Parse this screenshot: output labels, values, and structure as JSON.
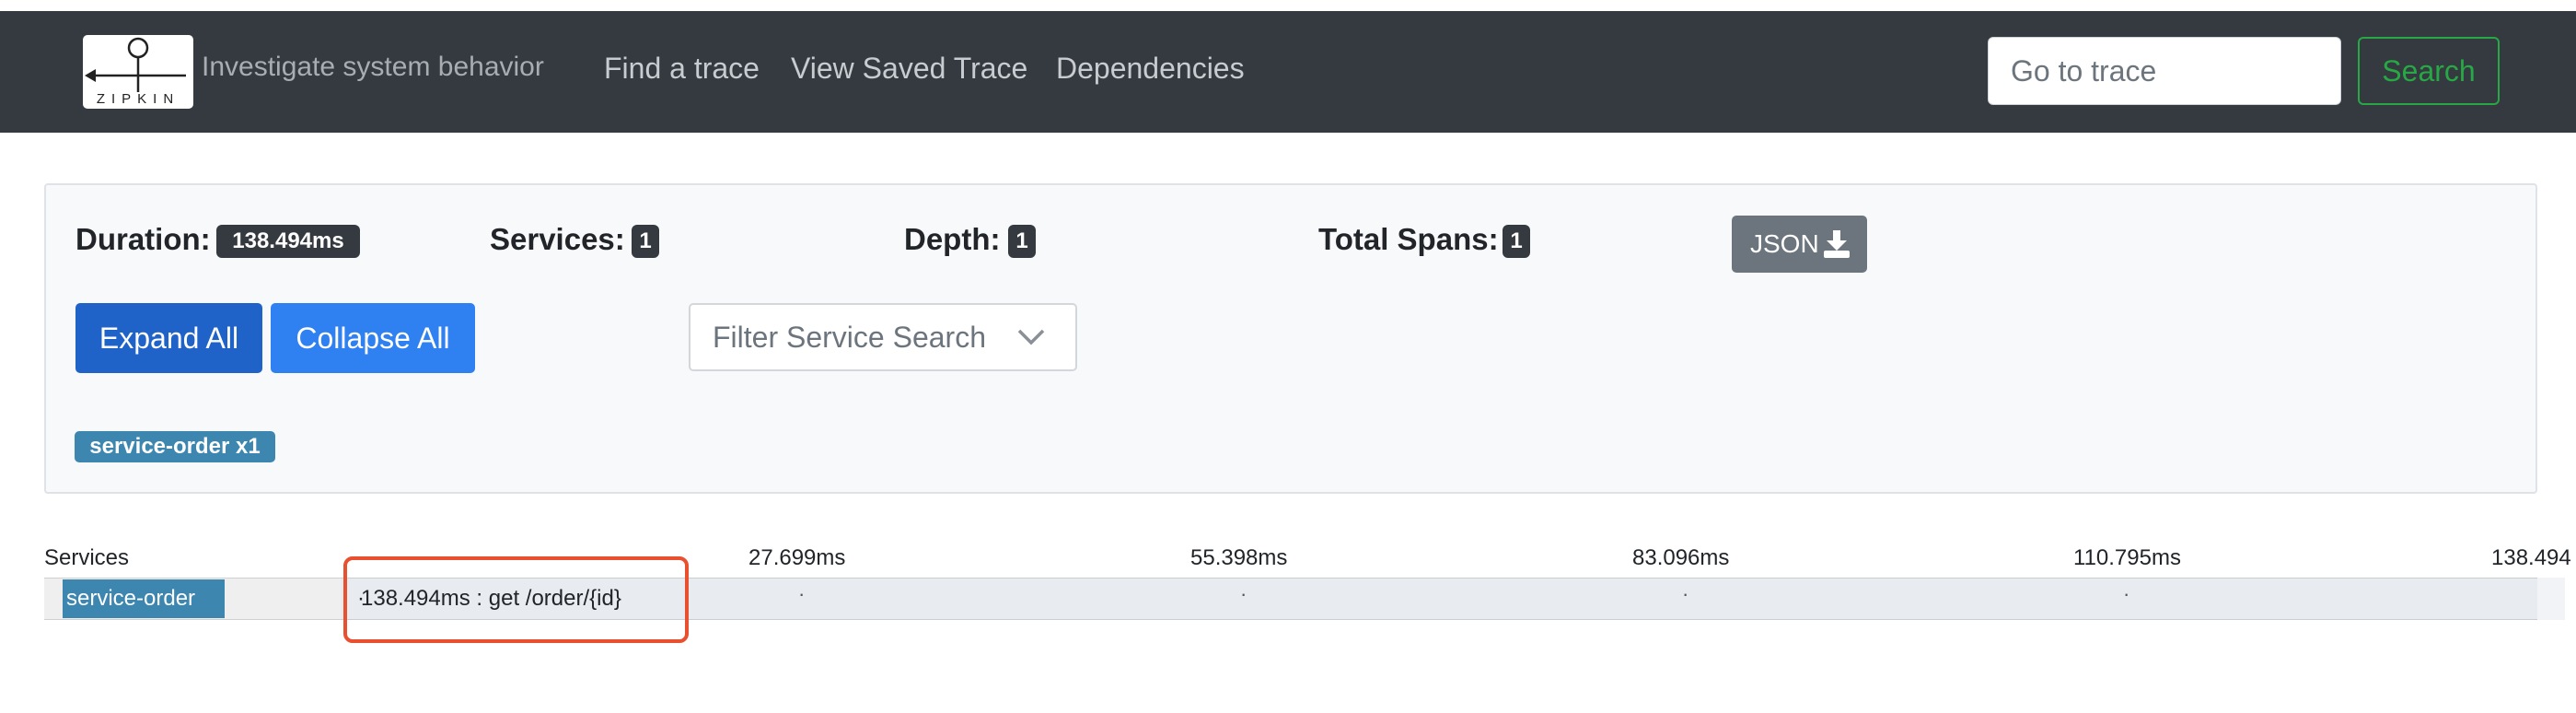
{
  "navbar": {
    "logo_text": "ZIPKIN",
    "tagline": "Investigate system behavior",
    "links": [
      "Find a trace",
      "View Saved Trace",
      "Dependencies"
    ],
    "goto_placeholder": "Go to trace",
    "search_label": "Search"
  },
  "summary": {
    "duration_label": "Duration:",
    "duration_value": "138.494ms",
    "services_label": "Services:",
    "services_value": "1",
    "depth_label": "Depth:",
    "depth_value": "1",
    "total_spans_label": "Total Spans:",
    "total_spans_value": "1",
    "json_label": "JSON",
    "expand_label": "Expand All",
    "collapse_label": "Collapse All",
    "filter_placeholder": "Filter Service Search",
    "service_badge": "service-order x1"
  },
  "timeline": {
    "services_header": "Services",
    "ticks": [
      "27.699ms",
      "55.398ms",
      "83.096ms",
      "110.795ms",
      "138.494"
    ],
    "rows": [
      {
        "service": "service-order",
        "span_text": "138.494ms : get /order/{id}",
        "prefix": "·"
      }
    ]
  },
  "colors": {
    "navbar_bg": "#343a40",
    "primary_blue": "#1f63c9",
    "secondary_blue": "#2f80f0",
    "success_green": "#28a745",
    "service_blue": "#3c86b0",
    "highlight_red": "#e8502f"
  },
  "icons": {
    "json_button": "download-icon",
    "filter_dropdown": "chevron-down-icon",
    "logo": "zipkin-logo-icon"
  }
}
